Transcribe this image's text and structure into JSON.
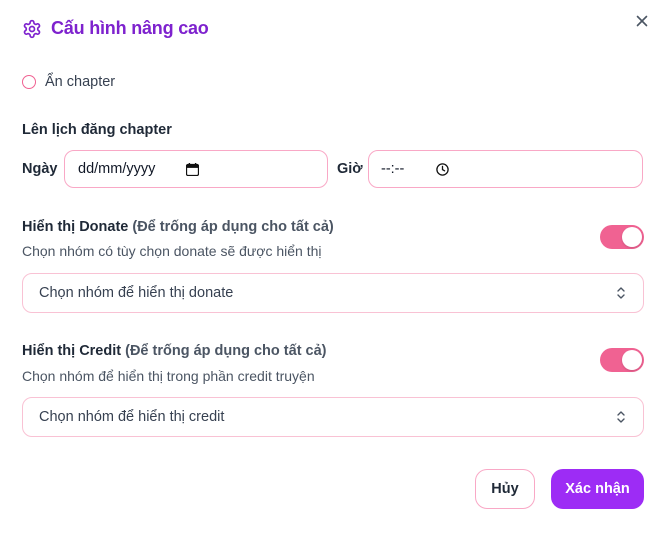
{
  "modal": {
    "title": "Cấu hình nâng cao",
    "accent_color": "#7e22ce"
  },
  "hide_chapter": {
    "label": "Ẩn chapter",
    "checked": false
  },
  "schedule": {
    "title": "Lên lịch đăng chapter",
    "date_label": "Ngày",
    "date_placeholder": "dd/mm/yyyy",
    "time_label": "Giờ",
    "time_placeholder": "--:--"
  },
  "donate": {
    "title": "Hiển thị Donate",
    "title_hint": "(Để trống áp dụng cho tất cả)",
    "description": "Chọn nhóm có tùy chọn donate sẽ được hiển thị",
    "enabled": true,
    "select_placeholder": "Chọn nhóm để hiển thị donate"
  },
  "credit": {
    "title": "Hiển thị Credit",
    "title_hint": "(Để trống áp dụng cho tất cả)",
    "description": "Chọn nhóm để hiển thị trong phần credit truyện",
    "enabled": true,
    "select_placeholder": "Chọn nhóm để hiển thị credit"
  },
  "actions": {
    "cancel_label": "Hủy",
    "confirm_label": "Xác nhận"
  },
  "colors": {
    "toggle_on": "#f06292",
    "confirm_bg": "#9d2cf5",
    "field_border": "#f9a8c6"
  },
  "icons": {
    "header": "gear-icon",
    "close": "close-icon",
    "date": "calendar-icon",
    "time": "clock-icon",
    "select": "chevron-up-down-icon"
  }
}
